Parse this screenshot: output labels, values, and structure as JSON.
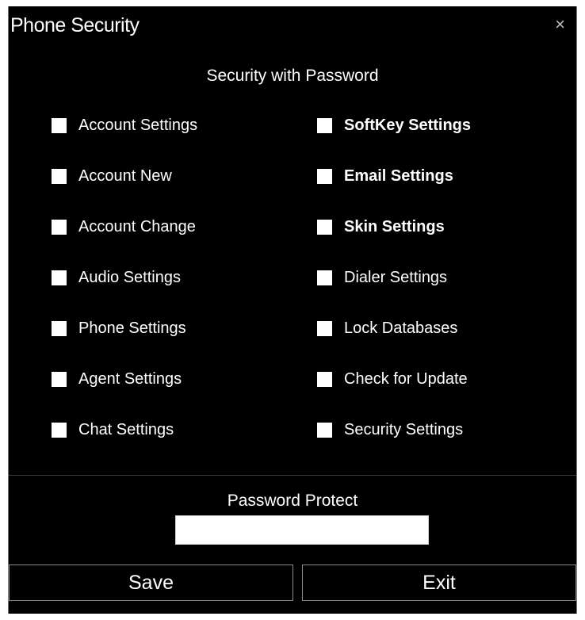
{
  "window": {
    "title": "Phone Security",
    "close_glyph": "×"
  },
  "header": {
    "subtitle": "Security with Password"
  },
  "checkboxes": {
    "left": [
      {
        "label": "Account Settings",
        "checked": false
      },
      {
        "label": "Account New",
        "checked": false
      },
      {
        "label": "Account Change",
        "checked": false
      },
      {
        "label": "Audio Settings",
        "checked": false
      },
      {
        "label": "Phone Settings",
        "checked": false
      },
      {
        "label": "Agent Settings",
        "checked": false
      },
      {
        "label": "Chat Settings",
        "checked": false
      }
    ],
    "right": [
      {
        "label": "SoftKey Settings",
        "checked": false
      },
      {
        "label": "Email Settings",
        "checked": false
      },
      {
        "label": "Skin Settings",
        "checked": false
      },
      {
        "label": "Dialer Settings",
        "checked": false
      },
      {
        "label": "Lock Databases",
        "checked": false
      },
      {
        "label": "Check for Update",
        "checked": false
      },
      {
        "label": "Security Settings",
        "checked": false
      }
    ]
  },
  "password": {
    "label": "Password Protect",
    "value": ""
  },
  "buttons": {
    "save": "Save",
    "exit": "Exit"
  },
  "colors": {
    "background": "#000000",
    "text": "#ffffff",
    "border": "#8a8a8a"
  }
}
